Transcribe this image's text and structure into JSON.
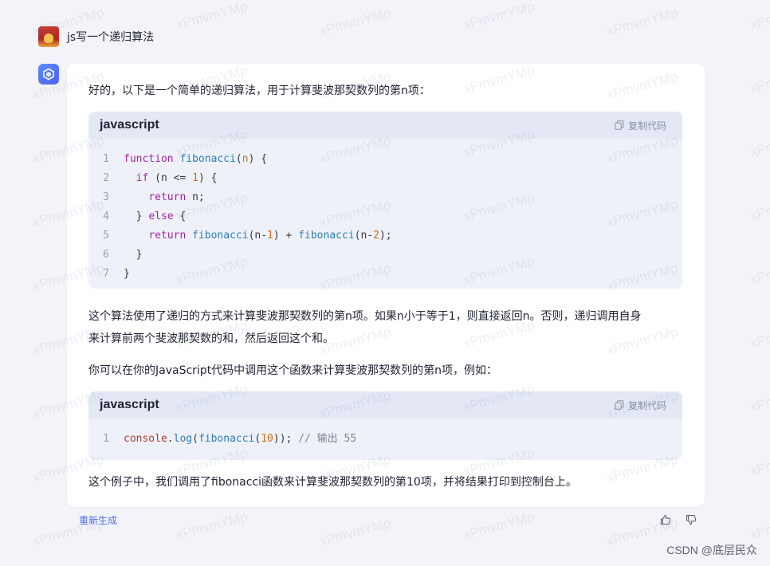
{
  "user": {
    "message": "js写一个递归算法"
  },
  "answer": {
    "intro": "好的，以下是一个简单的递归算法，用于计算斐波那契数列的第n项：",
    "code_block_1": {
      "lang": "javascript",
      "copy_label": "复制代码",
      "lines": [
        {
          "no": "1",
          "parts": [
            [
              "kw",
              "function "
            ],
            [
              "fn",
              "fibonacci"
            ],
            [
              "",
              "("
            ],
            [
              "param",
              "n"
            ],
            [
              "",
              ") {"
            ]
          ]
        },
        {
          "no": "2",
          "parts": [
            [
              "",
              "  "
            ],
            [
              "kw",
              "if"
            ],
            [
              "",
              " (n <= "
            ],
            [
              "num",
              "1"
            ],
            [
              "",
              ") {"
            ]
          ]
        },
        {
          "no": "3",
          "parts": [
            [
              "",
              "    "
            ],
            [
              "kw",
              "return"
            ],
            [
              "",
              " n;"
            ]
          ]
        },
        {
          "no": "4",
          "parts": [
            [
              "",
              "  } "
            ],
            [
              "kw",
              "else"
            ],
            [
              "",
              " {"
            ]
          ]
        },
        {
          "no": "5",
          "parts": [
            [
              "",
              "    "
            ],
            [
              "kw",
              "return "
            ],
            [
              "fn",
              "fibonacci"
            ],
            [
              "",
              "(n-"
            ],
            [
              "num",
              "1"
            ],
            [
              "",
              ") + "
            ],
            [
              "fn",
              "fibonacci"
            ],
            [
              "",
              "(n-"
            ],
            [
              "num",
              "2"
            ],
            [
              "",
              ");"
            ]
          ]
        },
        {
          "no": "6",
          "parts": [
            [
              "",
              "  }"
            ]
          ]
        },
        {
          "no": "7",
          "parts": [
            [
              "",
              "}"
            ]
          ]
        }
      ]
    },
    "explain_line_1": "这个算法使用了递归的方式来计算斐波那契数列的第n项。如果n小于等于1，则直接返回n。否则，递归调用自身",
    "explain_line_2": "来计算前两个斐波那契数的和，然后返回这个和。",
    "usage_intro": "你可以在你的JavaScript代码中调用这个函数来计算斐波那契数列的第n项，例如：",
    "code_block_2": {
      "lang": "javascript",
      "copy_label": "复制代码",
      "lines": [
        {
          "no": "1",
          "parts": [
            [
              "obj",
              "console"
            ],
            [
              "",
              "."
            ],
            [
              "fn",
              "log"
            ],
            [
              "",
              "("
            ],
            [
              "fn",
              "fibonacci"
            ],
            [
              "",
              "("
            ],
            [
              "num",
              "10"
            ],
            [
              "",
              ")); "
            ],
            [
              "cmt",
              "// 输出 55"
            ]
          ]
        }
      ]
    },
    "conclusion": "这个例子中，我们调用了fibonacci函数来计算斐波那契数列的第10项，并将结果打印到控制台上。"
  },
  "actions": {
    "regenerate_label": "重新生成",
    "thumbs_up_icon": "thumbs-up-icon",
    "thumbs_down_icon": "thumbs-down-icon"
  },
  "watermark": {
    "text": "xPmvmYMp"
  },
  "site_mark": "CSDN @底层民众"
}
